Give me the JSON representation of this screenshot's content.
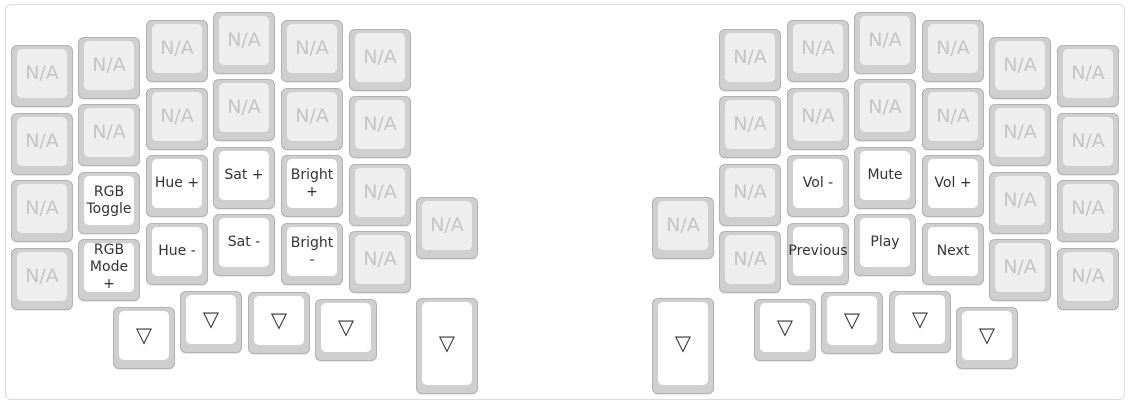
{
  "keyboard": {
    "left": {
      "keys": [
        "N/A",
        "N/A",
        "N/A",
        "N/A",
        "N/A",
        "N/A",
        "N/A",
        "N/A",
        "N/A",
        "N/A",
        "N/A",
        "N/A",
        "N/A",
        "RGB\nToggle",
        "Hue +",
        "Sat +",
        "Bright\n+",
        "N/A",
        "N/A",
        "RGB\nMode +",
        "Hue -",
        "Sat -",
        "Bright\n-",
        "N/A",
        "▽",
        "▽",
        "▽",
        "▽",
        "N/A",
        "▽"
      ]
    },
    "right": {
      "keys": [
        "N/A",
        "N/A",
        "N/A",
        "N/A",
        "N/A",
        "N/A",
        "N/A",
        "N/A",
        "N/A",
        "N/A",
        "N/A",
        "N/A",
        "N/A",
        "Vol -",
        "Mute",
        "Vol +",
        "N/A",
        "N/A",
        "N/A",
        "Previous",
        "Play",
        "Next",
        "N/A",
        "N/A",
        "▽",
        "▽",
        "▽",
        "▽",
        "N/A",
        "▽"
      ]
    }
  }
}
